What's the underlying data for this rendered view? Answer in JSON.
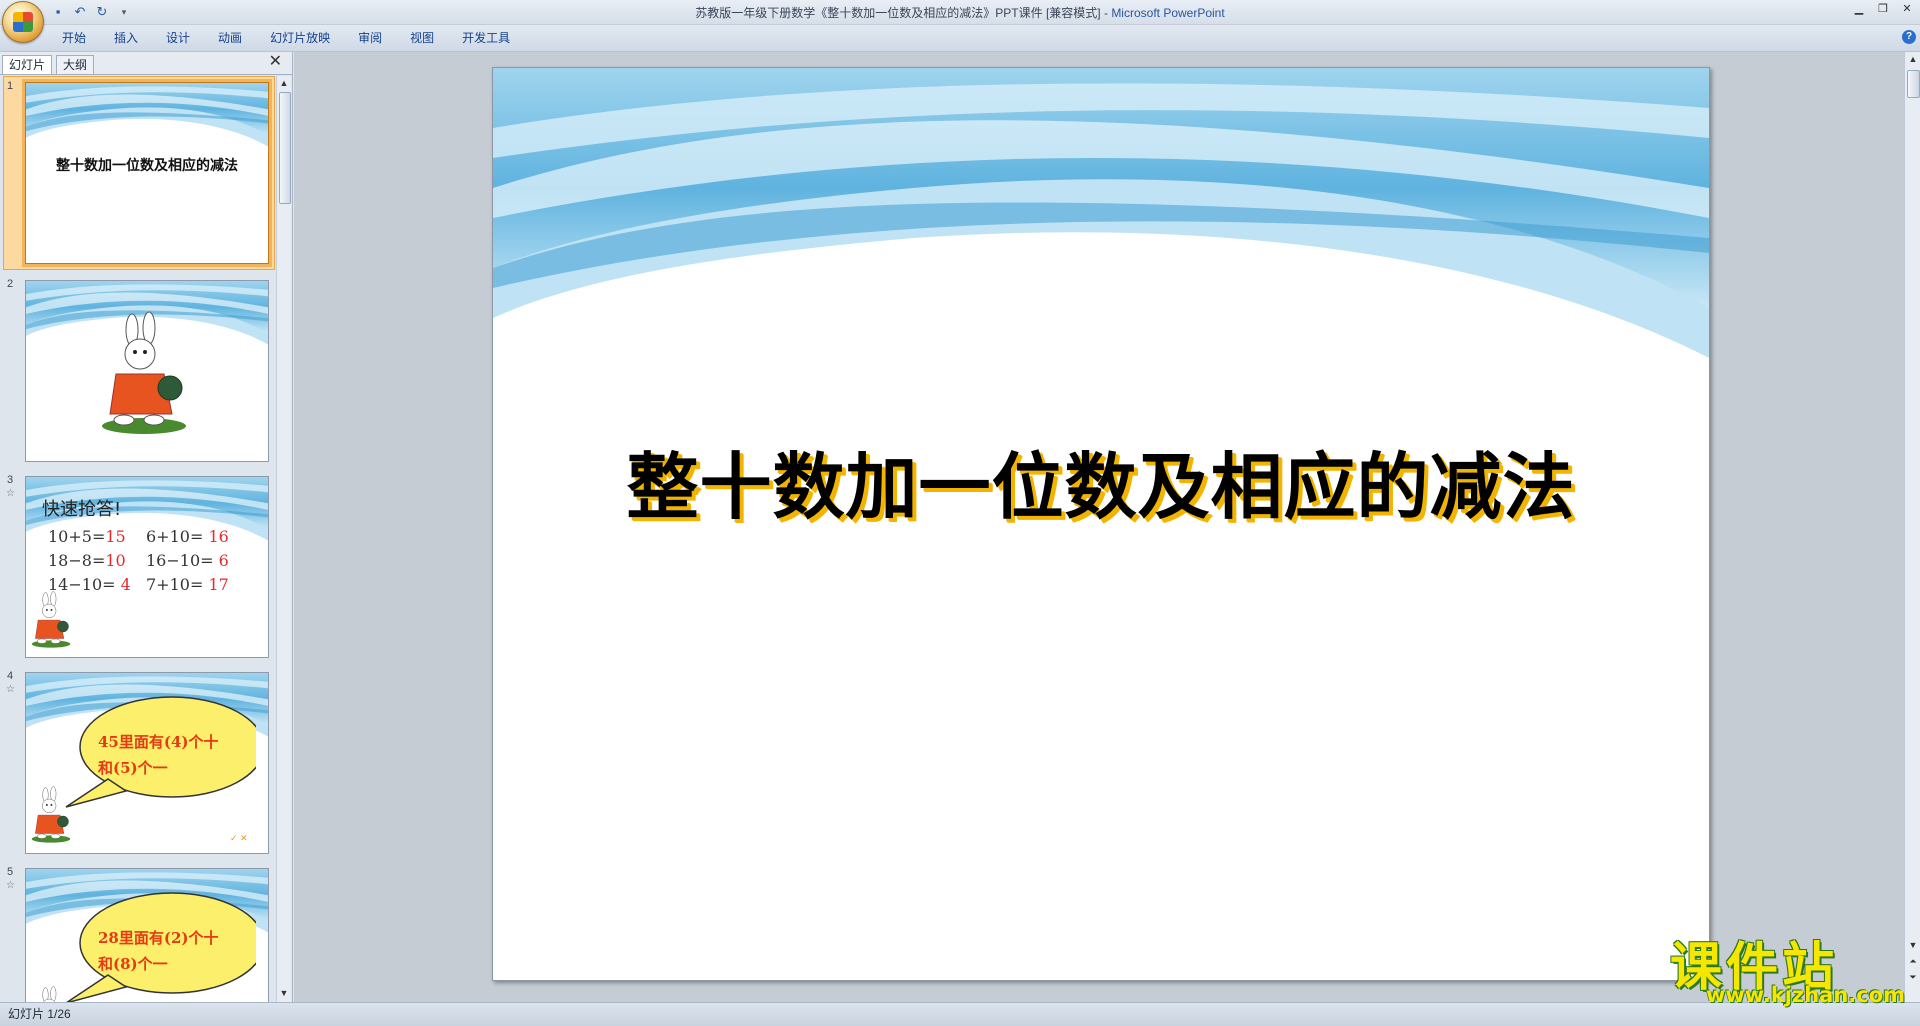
{
  "window": {
    "title": "苏教版一年级下册数学《整十数加一位数及相应的减法》PPT课件 [兼容模式] - ",
    "app_name": "Microsoft PowerPoint"
  },
  "ribbon": {
    "tabs": [
      "开始",
      "插入",
      "设计",
      "动画",
      "幻灯片放映",
      "审阅",
      "视图",
      "开发工具"
    ]
  },
  "pane": {
    "tabs": [
      "幻灯片",
      "大纲"
    ]
  },
  "slides": {
    "s1": {
      "num": "1",
      "title": "整十数加一位数及相应的减法"
    },
    "s2": {
      "num": "2"
    },
    "s3": {
      "num": "3",
      "heading": "快速抢答!",
      "equations": [
        {
          "q": "10+5=",
          "a": "15"
        },
        {
          "q": "6+10= ",
          "a": "16"
        },
        {
          "q": "18−8=",
          "a": "10"
        },
        {
          "q": "16−10= ",
          "a": "6"
        },
        {
          "q": "14−10= ",
          "a": "4"
        },
        {
          "q": "7+10= ",
          "a": "17"
        }
      ]
    },
    "s4": {
      "num": "4",
      "line1": "45里面有(4)个十",
      "line2": "和(5)个一"
    },
    "s5": {
      "num": "5",
      "line1": "28里面有(2)个十",
      "line2": "和(8)个一"
    }
  },
  "main_slide": {
    "title": "整十数加一位数及相应的减法"
  },
  "status": {
    "text": "幻灯片 1/26"
  },
  "watermark": {
    "big": "课件站",
    "small": "www.kjzhan.com"
  },
  "colors": {
    "selection": "#f2b35a",
    "sky": "#5fb3df",
    "title_shadow": "#f2b400",
    "answer": "#e62a2a"
  }
}
